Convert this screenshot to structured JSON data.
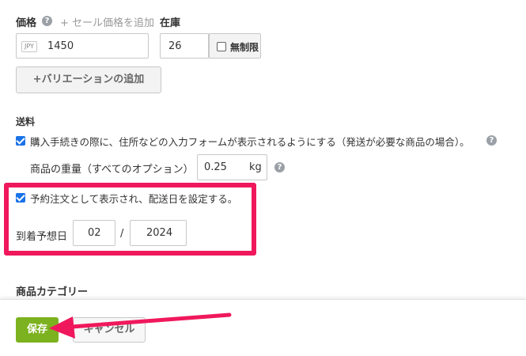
{
  "price": {
    "label": "価格",
    "add_sale_price_link": "+ セール価格を追加",
    "currency_badge": "JPY",
    "value": "1450"
  },
  "stock": {
    "label": "在庫",
    "value": "26",
    "unlimited_label": "無制限",
    "unlimited_checked": false
  },
  "variation": {
    "add_button_label": "+バリエーションの追加"
  },
  "shipping": {
    "section_title": "送料",
    "address_form_label": "購入手続きの際に、住所などの入力フォームが表示されるようにする（発送が必要な商品の場合）。",
    "address_form_checked": true,
    "weight_label": "商品の重量（すべてのオプション）",
    "weight_value": "0.25",
    "weight_unit": "kg"
  },
  "preorder": {
    "label": "予約注文として表示され、配送日を設定する。",
    "checked": true,
    "arrival_label": "到着予想日",
    "month_value": "02",
    "separator": "/",
    "year_value": "2024",
    "highlight_color": "#f0185c"
  },
  "category": {
    "section_title": "商品カテゴリー"
  },
  "footer": {
    "save_label": "保存",
    "cancel_label": "キャンセル",
    "save_color": "#7cb21f"
  },
  "annotation": {
    "arrow_color": "#f0185c"
  }
}
